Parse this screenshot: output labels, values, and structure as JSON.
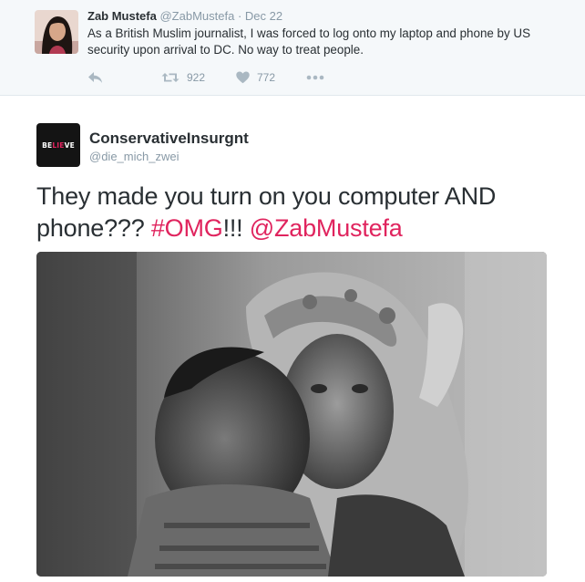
{
  "quoted_tweet": {
    "name": "Zab Mustefa",
    "handle": "@ZabMustefa",
    "separator": "·",
    "date": "Dec 22",
    "text": "As a British Muslim journalist, I was forced to log onto my laptop and phone by US security upon arrival to DC. No way to treat people.",
    "actions": {
      "reply_icon": "reply-icon",
      "retweet_icon": "retweet-icon",
      "retweet_count": "922",
      "like_icon": "heart-icon",
      "like_count": "772",
      "more_icon": "more-icon"
    }
  },
  "main_tweet": {
    "avatar_text_start": "BE",
    "avatar_text_mid": "LIE",
    "avatar_text_end": "VE",
    "name": "ConservativeInsurgnt",
    "handle": "@die_mich_zwei",
    "text_part1": "They made you turn on you computer AND phone??? ",
    "hashtag": "#OMG",
    "text_part2": "!!! ",
    "mention": "@ZabMustefa"
  },
  "colors": {
    "accent": "#e0245e",
    "muted": "#8899a6",
    "icon": "#aab8c2",
    "text": "#292f33",
    "quoted_bg": "#f5f8fa"
  }
}
